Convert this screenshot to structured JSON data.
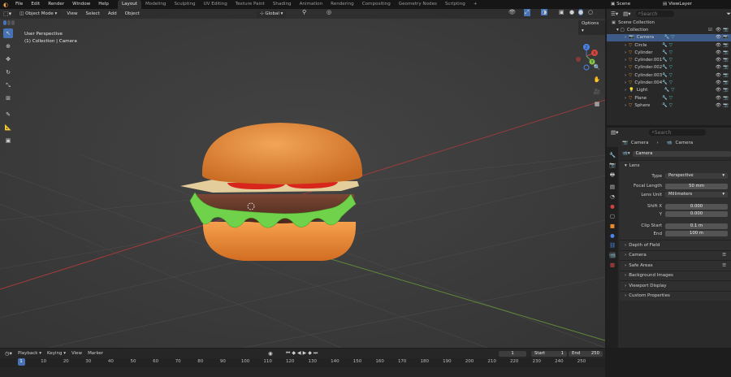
{
  "topbar": {
    "menus": [
      "File",
      "Edit",
      "Render",
      "Window",
      "Help"
    ],
    "workspaces": [
      "Layout",
      "Modeling",
      "Sculpting",
      "UV Editing",
      "Texture Paint",
      "Shading",
      "Animation",
      "Rendering",
      "Compositing",
      "Geometry Nodes",
      "Scripting"
    ],
    "active_workspace": "Layout",
    "add_tab": "+",
    "scene": "Scene",
    "view_layer": "ViewLayer"
  },
  "viewport": {
    "mode": "Object Mode",
    "menus": [
      "View",
      "Select",
      "Add",
      "Object"
    ],
    "orientation": "Global",
    "overlay_line1": "User Perspective",
    "overlay_line2": "(1) Collection | Camera",
    "options_label": "Options",
    "gizmo_x": "X",
    "gizmo_y": "Y",
    "gizmo_z": "Z"
  },
  "outliner": {
    "search_placeholder": "Search",
    "root": "Scene Collection",
    "collection": "Collection",
    "items": [
      "Camera",
      "Circle",
      "Cylinder",
      "Cylinder.001",
      "Cylinder.002",
      "Cylinder.003",
      "Cylinder.004",
      "Light",
      "Plane",
      "Sphere"
    ],
    "selected": "Camera"
  },
  "properties": {
    "search_placeholder": "Search",
    "breadcrumb_object": "Camera",
    "breadcrumb_data": "Camera",
    "datablock": "Camera",
    "lens_section": "Lens",
    "type_label": "Type",
    "type_value": "Perspective",
    "focal_label": "Focal Length",
    "focal_value": "50 mm",
    "lens_unit_label": "Lens Unit",
    "lens_unit_value": "Millimeters",
    "shift_x_label": "Shift X",
    "shift_x_value": "0.000",
    "shift_y_label": "Y",
    "shift_y_value": "0.000",
    "clip_start_label": "Clip Start",
    "clip_start_value": "0.1 m",
    "clip_end_label": "End",
    "clip_end_value": "100 m",
    "sections": [
      "Depth of Field",
      "Camera",
      "Safe Areas",
      "Background Images",
      "Viewport Display",
      "Custom Properties"
    ]
  },
  "timeline": {
    "menus": [
      "Playback",
      "Keying",
      "View",
      "Marker"
    ],
    "current_frame": "1",
    "start_label": "Start",
    "start_value": "1",
    "end_label": "End",
    "end_value": "250",
    "ticks": [
      "1",
      "10",
      "20",
      "30",
      "40",
      "50",
      "60",
      "70",
      "80",
      "90",
      "100",
      "110",
      "120",
      "130",
      "140",
      "150",
      "160",
      "170",
      "180",
      "190",
      "200",
      "210",
      "220",
      "230",
      "240",
      "250"
    ]
  },
  "colors": {
    "accent": "#4772b3",
    "selection": "#3e5a87",
    "bun": "#e8883a",
    "patty": "#5a3426",
    "lettuce": "#6fd24a",
    "tomato": "#d8261c",
    "cheese": "#e3cd9a"
  }
}
